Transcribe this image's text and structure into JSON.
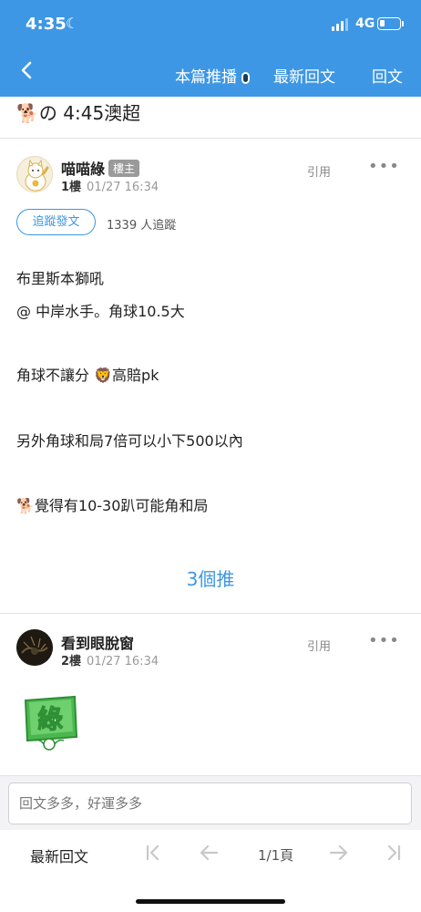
{
  "status_bar": {
    "time": "4:35",
    "network": "4G",
    "battery_level": 0.25
  },
  "nav": {
    "back_icon": "chevron-left-icon",
    "this_post_push": "本篇推播",
    "latest_reply": "最新回文",
    "reply": "回文"
  },
  "thread": {
    "title": "の 4:45澳超"
  },
  "posts": [
    {
      "username": "喵喵綠",
      "badge": "樓主",
      "floor": "1樓",
      "time": "01/27 16:34",
      "quote": "引用",
      "more": "•••",
      "follow_button": "追蹤發文",
      "follow_count": "1339 人追蹤",
      "lines": [
        "布里斯本獅吼",
        "@ 中岸水手。角球10.5大",
        "角球不讓分",
        "高賠pk",
        "另外角球和局7倍可以小下500以內",
        "覺得有10-30趴可能角和局"
      ],
      "push_count": "3個推"
    },
    {
      "username": "看到眼脫窗",
      "floor": "2樓",
      "time": "01/27 16:34",
      "quote": "引用",
      "more": "•••",
      "sticker_text": "綠"
    }
  ],
  "reply_box": {
    "placeholder": "回文多多，好運多多"
  },
  "pager": {
    "latest": "最新回文",
    "first_icon": "first-page-icon",
    "prev_icon": "arrow-left-icon",
    "page": "1/1頁",
    "next_icon": "arrow-right-icon",
    "last_icon": "last-page-icon"
  },
  "colors": {
    "accent": "#3d97e4",
    "header_bg": "#3d97e4"
  }
}
